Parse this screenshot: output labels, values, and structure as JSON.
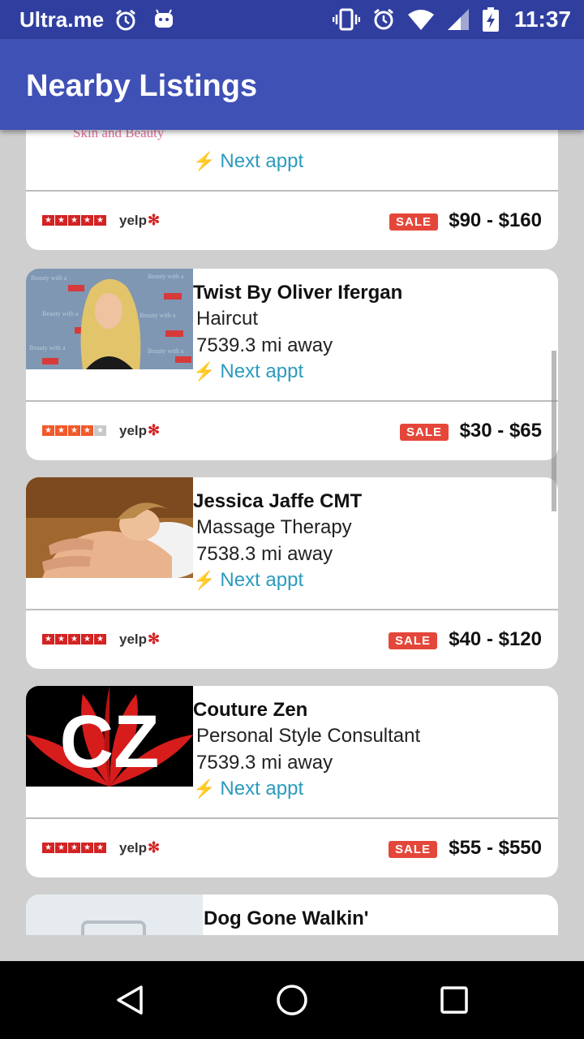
{
  "status_bar": {
    "app_name": "Ultra.me",
    "time": "11:37"
  },
  "app_bar": {
    "title": "Nearby Listings"
  },
  "partial_top": {
    "logo_text": "Skin and Beauty",
    "next_appt": "Next appt",
    "sale": "SALE",
    "price": "$90 - $160",
    "yelp": "yelp",
    "rating": 5
  },
  "listings": [
    {
      "name": "Twist By Oliver Ifergan",
      "category": "Haircut",
      "distance": "7539.3 mi away",
      "next_appt": "Next appt",
      "sale": "SALE",
      "price": "$30 - $65",
      "yelp": "yelp",
      "rating": 4
    },
    {
      "name": "Jessica Jaffe CMT",
      "category": "Massage Therapy",
      "distance": "7538.3 mi away",
      "next_appt": "Next appt",
      "sale": "SALE",
      "price": "$40 - $120",
      "yelp": "yelp",
      "rating": 5
    },
    {
      "name": "Couture Zen",
      "category": "Personal Style Consultant",
      "distance": "7539.3 mi away",
      "next_appt": "Next appt",
      "sale": "SALE",
      "price": "$55 - $550",
      "yelp": "yelp",
      "rating": 5,
      "logo_text": "CZ"
    }
  ],
  "partial_bottom": {
    "name": "Dog Gone Walkin'"
  },
  "colors": {
    "primary": "#3f51b5",
    "primary_dark": "#303f9f",
    "link": "#2b9bbd",
    "sale": "#e4473a",
    "yelp_red": "#d32323"
  }
}
